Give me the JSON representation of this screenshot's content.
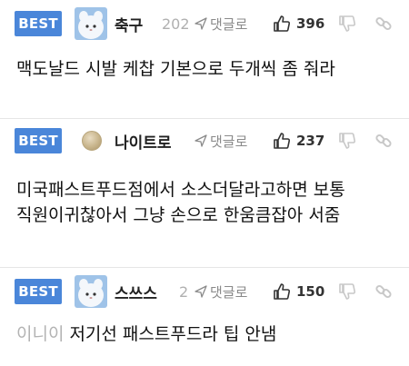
{
  "comments": [
    {
      "badge": "BEST",
      "nickname": "축구",
      "date": "202",
      "reply_label": "댓글로",
      "likes": "396",
      "text": "맥도날드 시발 케찹 기본으로 두개씩 좀 줘라",
      "mention": ""
    },
    {
      "badge": "BEST",
      "nickname": "나이트로",
      "date": "",
      "reply_label": "댓글로",
      "likes": "237",
      "text": "미국패스트푸드점에서 소스더달라고하면 보통 직원이귀찮아서 그냥 손으로 한움큼잡아 서줌",
      "mention": ""
    },
    {
      "badge": "BEST",
      "nickname": "스쓰스",
      "date": "2",
      "reply_label": "댓글로",
      "likes": "150",
      "text": "저기선 패스트푸드라 팁 안냄",
      "mention": "이니이"
    }
  ],
  "icons": {
    "reply": "reply-arrow-icon",
    "like": "thumbs-up-icon",
    "dislike": "thumbs-down-icon",
    "link": "link-icon"
  },
  "colors": {
    "badge": "#4a86d9",
    "muted": "#b0b0b0",
    "divider": "#e6e6e6"
  }
}
